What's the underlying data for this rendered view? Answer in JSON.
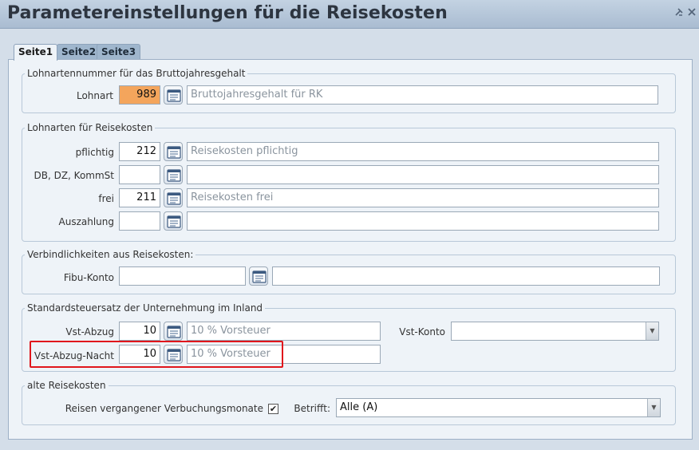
{
  "window": {
    "title": "Parametereinstellungen für die Reisekosten",
    "pin_icon": "pin-icon",
    "close_icon": "close-icon"
  },
  "tabs": [
    {
      "label": "Seite1",
      "active": true
    },
    {
      "label": "Seite2",
      "active": false
    },
    {
      "label": "Seite3",
      "active": false
    }
  ],
  "brutto": {
    "legend": "Lohnartennummer für das Bruttojahresgehalt",
    "lohnart_label": "Lohnart",
    "lohnart_value": "989",
    "lohnart_desc": "Bruttojahresgehalt für RK",
    "highlight_color": "#f4a55c"
  },
  "reisekosten": {
    "legend": "Lohnarten für Reisekosten",
    "rows": [
      {
        "label": "pflichtig",
        "value": "212",
        "desc": "Reisekosten pflichtig"
      },
      {
        "label": "DB, DZ, KommSt",
        "value": "",
        "desc": ""
      },
      {
        "label": "frei",
        "value": "211",
        "desc": "Reisekosten frei"
      },
      {
        "label": "Auszahlung",
        "value": "",
        "desc": ""
      }
    ]
  },
  "verbindlichkeiten": {
    "legend": "Verbindlichkeiten aus Reisekosten:",
    "fibu_label": "Fibu-Konto",
    "fibu_value": "",
    "fibu_desc": ""
  },
  "steuersatz": {
    "legend": "Standardsteuersatz der Unternehmung im Inland",
    "vst_abzug_label": "Vst-Abzug",
    "vst_abzug_value": "10",
    "vst_abzug_desc": "10 % Vorsteuer",
    "vst_konto_label": "Vst-Konto",
    "vst_konto_value": "",
    "vst_nacht_label": "Vst-Abzug-Nacht",
    "vst_nacht_value": "10",
    "vst_nacht_desc": "10 % Vorsteuer",
    "highlight_border_color": "#e0161c"
  },
  "alte": {
    "legend": "alte Reisekosten",
    "checkbox_label": "Reisen vergangener Verbuchungsmonate",
    "checkbox_checked": true,
    "checkbox_mark": "✔",
    "betrifft_label": "Betrifft:",
    "betrifft_value": "Alle (A)"
  }
}
